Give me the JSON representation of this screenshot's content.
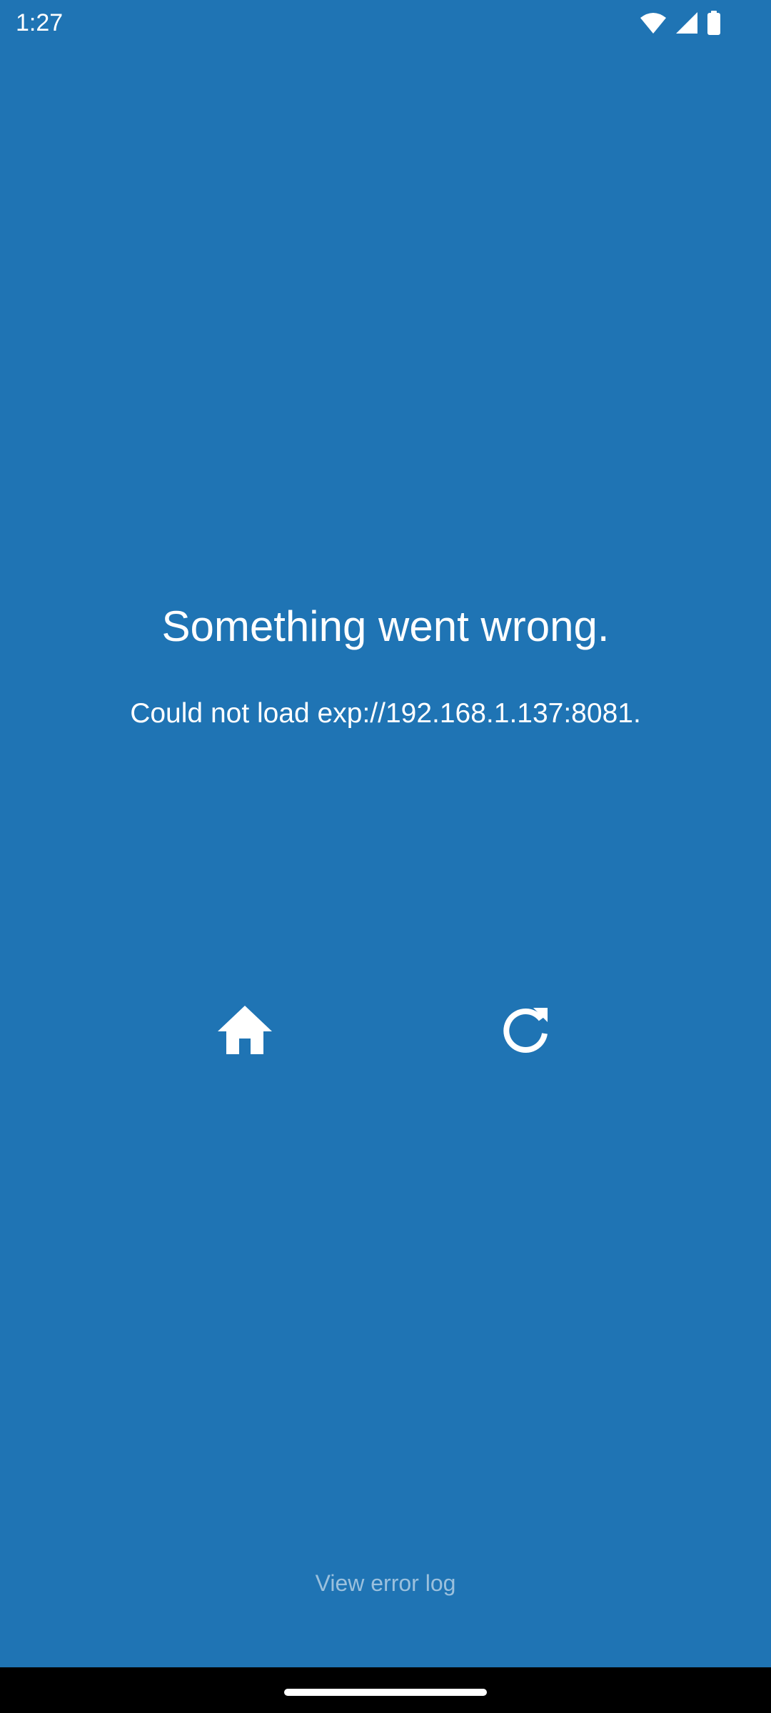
{
  "status_bar": {
    "time": "1:27",
    "icons": [
      "wifi-icon",
      "cell-signal-icon",
      "battery-icon"
    ]
  },
  "error": {
    "title": "Something went wrong.",
    "message": "Could not load exp://192.168.1.137:8081."
  },
  "actions": {
    "home_icon": "home-icon",
    "reload_icon": "reload-icon"
  },
  "footer": {
    "error_log_label": "View error log"
  },
  "colors": {
    "background": "#1F74B4",
    "text": "#FFFFFF",
    "nav_bar": "#000000"
  }
}
